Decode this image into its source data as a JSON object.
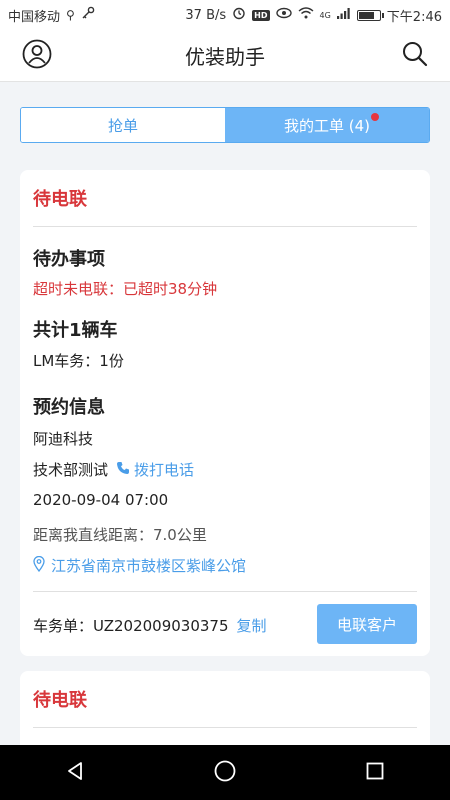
{
  "status_bar": {
    "carrier": "中国移动",
    "speed": "37 B/s",
    "hd_badge": "HD",
    "network": "4G",
    "time": "下午2:46",
    "icons": [
      "usb-icon",
      "key-icon",
      "alarm-icon",
      "eye-icon",
      "wifi-icon",
      "signal-icon",
      "battery-icon"
    ],
    "battery_level": 0.85
  },
  "app_bar": {
    "title": "优装助手",
    "icons": [
      "profile-icon",
      "search-icon"
    ]
  },
  "tabs": [
    {
      "label": "抢单",
      "active": false
    },
    {
      "label": "我的工单 (4)",
      "active": true,
      "has_dot": true
    }
  ],
  "cards": [
    {
      "status": "待电联",
      "todo_title": "待办事项",
      "timeout_text": "超时未电联：已超时38分钟",
      "car_count_title": "共计1辆车",
      "service_line": "LM车务：1份",
      "appointment_title": "预约信息",
      "company": "阿迪科技",
      "contact": "技术部测试",
      "call_label": "拨打电话",
      "datetime": "2020-09-04 07:00",
      "distance": "距离我直线距离：7.0公里",
      "address": "江苏省南京市鼓楼区紫峰公馆",
      "order_label": "车务单：UZ202009030375",
      "copy_label": "复制",
      "action_label": "电联客户"
    },
    {
      "status": "待电联"
    }
  ],
  "colors": {
    "accent": "#6db5f6",
    "accent_text": "#4a9de8",
    "danger": "#d8373b",
    "background": "#f2f4f7"
  },
  "nav_bar": {
    "icons": [
      "back-icon",
      "home-icon",
      "recents-icon"
    ]
  }
}
